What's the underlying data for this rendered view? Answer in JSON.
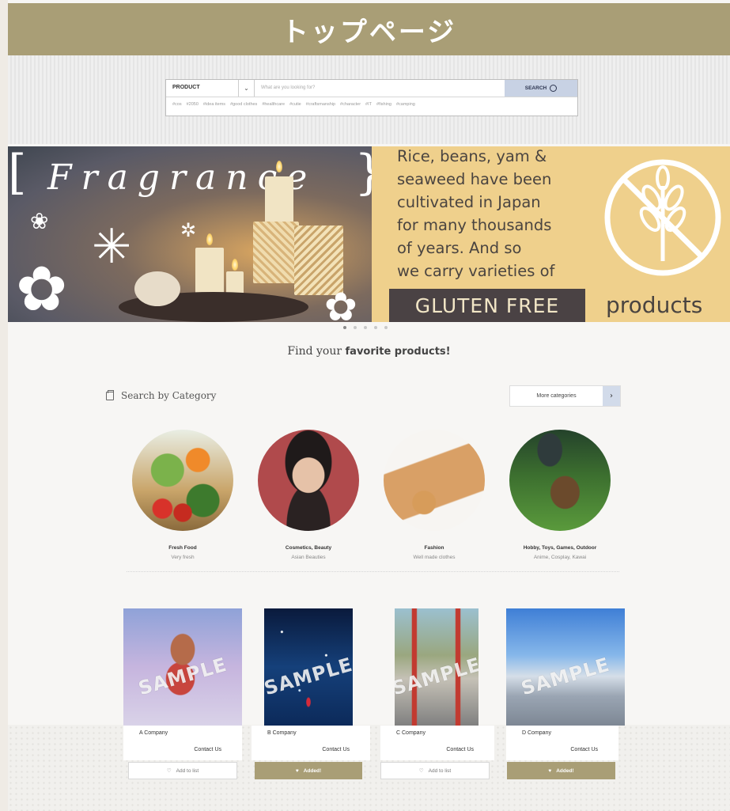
{
  "page_title": "トップページ",
  "search": {
    "category": "PRODUCT",
    "placeholder": "What are you looking for?",
    "button_label": "SEARCH",
    "tags": [
      "#cos",
      "#2050",
      "#idea items",
      "#good clothes",
      "#healthcare",
      "#cutie",
      "#craftsmanship",
      "#character",
      "#IT",
      "#fishing",
      "#camping"
    ]
  },
  "hero": {
    "left_word": "Fragrance",
    "right_lines": [
      "Rice, beans, yam &",
      "seaweed have been",
      "cultivated in Japan",
      "for many thousands",
      "of years. And so",
      "we carry varieties of"
    ],
    "gluten_label": "GLUTEN FREE",
    "products_label": "products",
    "slide_count": 5,
    "active_slide": 1
  },
  "find": {
    "prefix": "Find your ",
    "emphasis": "favorite products!"
  },
  "category_section": {
    "heading": "Search by Category",
    "more_label": "More categories",
    "items": [
      {
        "name": "Fresh Food",
        "sub": "Very fresh"
      },
      {
        "name": "Cosmetics, Beauty",
        "sub": "Asian Beauties"
      },
      {
        "name": "Fashion",
        "sub": "Well made clothes"
      },
      {
        "name": "Hobby, Toys, Games, Outdoor",
        "sub": "Anime, Cosplay, Kawai"
      }
    ]
  },
  "products": [
    {
      "company": "A Company",
      "contact": "Contact Us",
      "watermark": "SAMPLE",
      "button": "Add to list",
      "state": "add"
    },
    {
      "company": "B Company",
      "contact": "Contact Us",
      "watermark": "SAMPLE",
      "button": "Added!",
      "state": "added"
    },
    {
      "company": "C Company",
      "contact": "Contact Us",
      "watermark": "SAMPLE",
      "button": "Add to list",
      "state": "add"
    },
    {
      "company": "D Company",
      "contact": "Contact Us",
      "watermark": "SAMPLE",
      "button": "Added!",
      "state": "added"
    }
  ],
  "colors": {
    "accent": "#a99e76",
    "hero_right_bg": "#efd08c",
    "search_button": "#c8d2e4"
  }
}
